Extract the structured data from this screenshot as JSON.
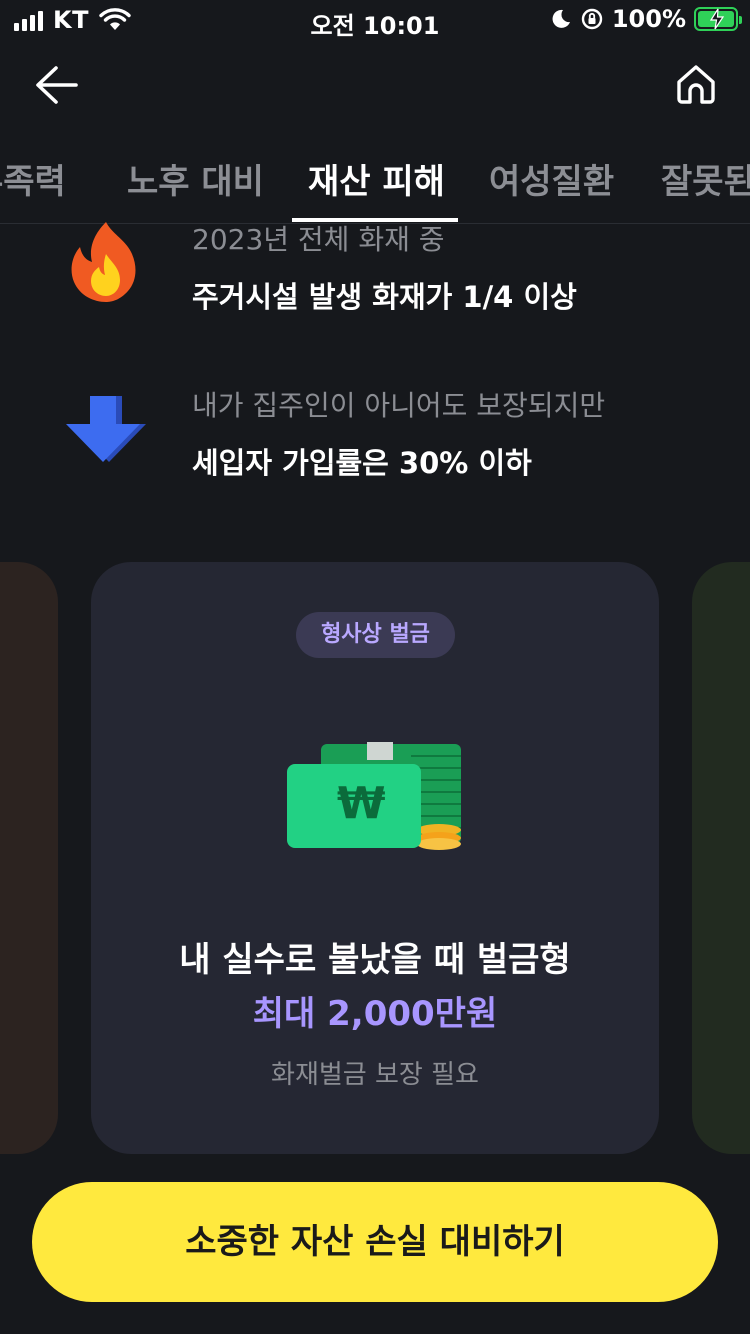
{
  "status_bar": {
    "carrier": "KT",
    "time": "오전 10:01",
    "battery": "100%"
  },
  "tabs": [
    {
      "label": "부족력"
    },
    {
      "label": "노후 대비"
    },
    {
      "label": "재산 피해"
    },
    {
      "label": "여성질환"
    },
    {
      "label": "잘못된"
    }
  ],
  "active_tab": "재산 피해",
  "info": [
    {
      "icon": "fire-icon",
      "sub": "2023년 전체 화재 중",
      "main": "주거시설 발생 화재가 1/4 이상"
    },
    {
      "icon": "down-arrow-icon",
      "sub": "내가 집주인이 아니어도 보장되지만",
      "main": "세입자 가입률은 30% 이하"
    }
  ],
  "card": {
    "badge": "형사상 벌금",
    "illustration": "money-bundle-icon",
    "title": "내 실수로 불났을 때 벌금형",
    "amount": "최대 2,000만원",
    "note": "화재벌금 보장 필요"
  },
  "cta": {
    "label": "소중한 자산 손실 대비하기"
  },
  "colors": {
    "background": "#16181c",
    "card": "#252733",
    "accent_purple": "#a896ff",
    "cta_yellow": "#ffe93e"
  }
}
